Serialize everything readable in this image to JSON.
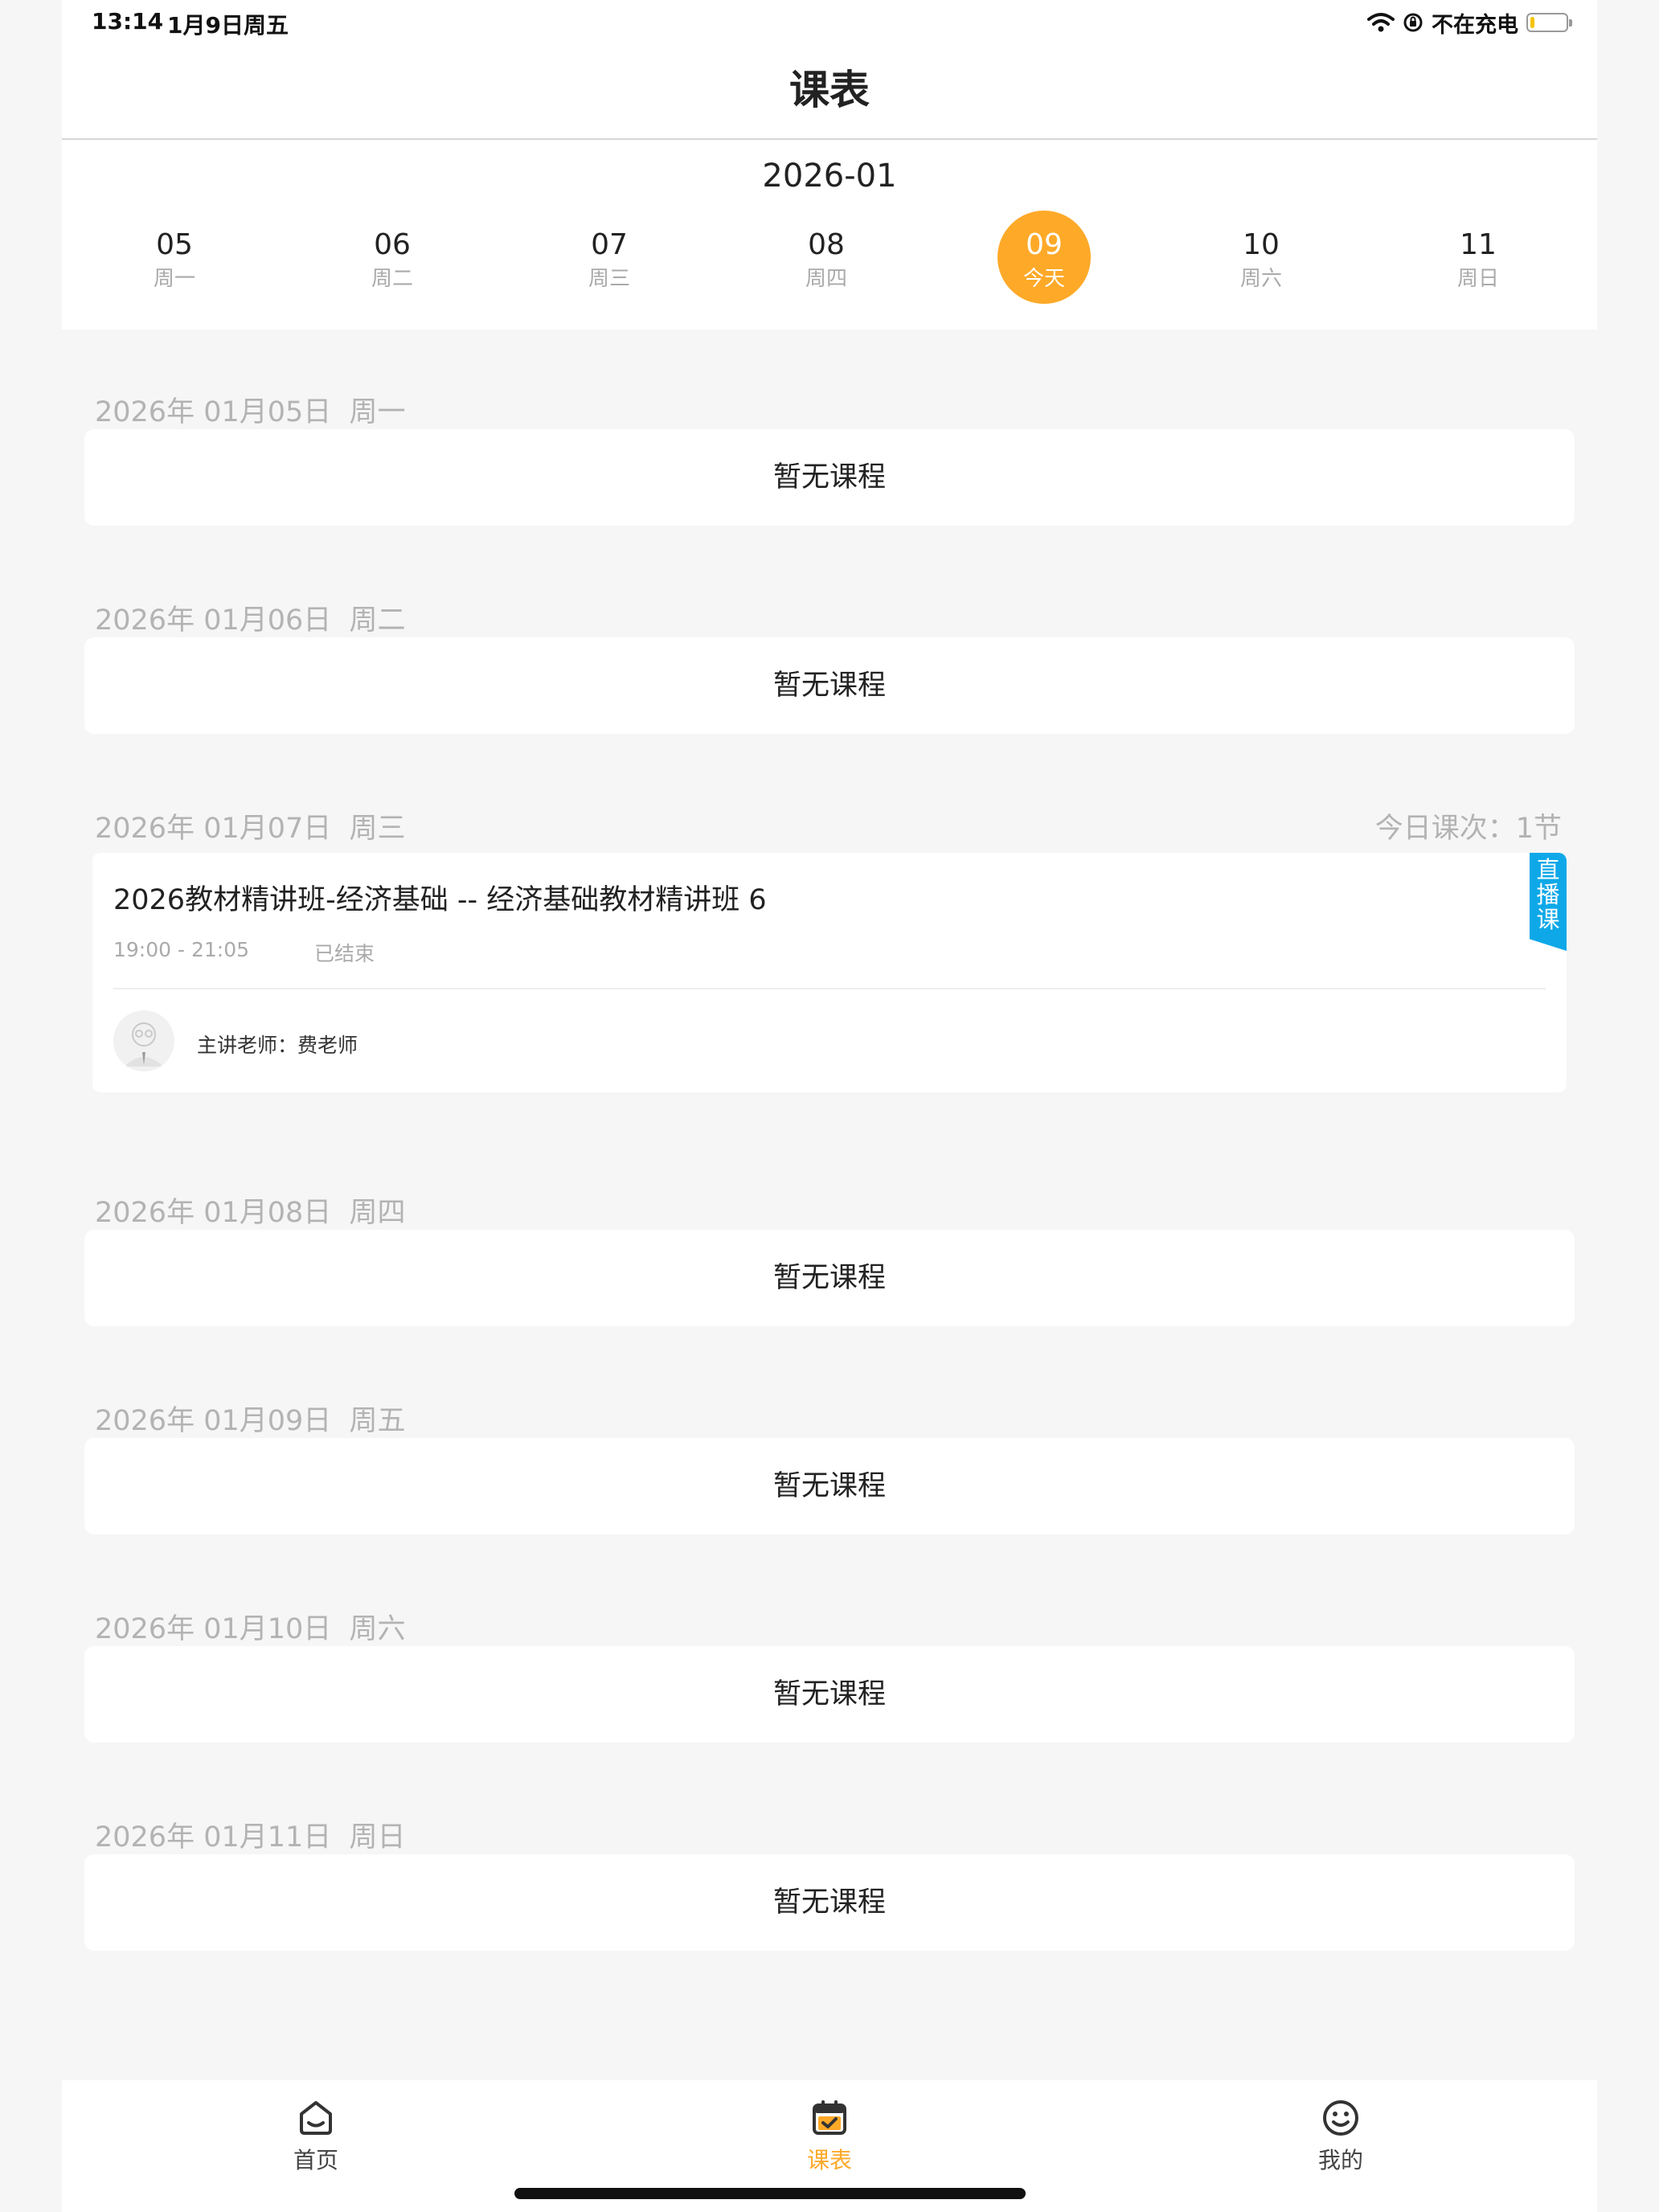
{
  "status_bar": {
    "time": "13:14",
    "date": "1月9日周五",
    "charging": "不在充电",
    "battery_level": 0.12
  },
  "header": {
    "title": "课表"
  },
  "calendar": {
    "month": "2026-01",
    "days": [
      {
        "num": "05",
        "weekday": "周一",
        "today": false
      },
      {
        "num": "06",
        "weekday": "周二",
        "today": false
      },
      {
        "num": "07",
        "weekday": "周三",
        "today": false
      },
      {
        "num": "08",
        "weekday": "周四",
        "today": false
      },
      {
        "num": "09",
        "weekday": "今天",
        "today": true
      },
      {
        "num": "10",
        "weekday": "周六",
        "today": false
      },
      {
        "num": "11",
        "weekday": "周日",
        "today": false
      }
    ]
  },
  "schedule": [
    {
      "date": "2026年 01月05日",
      "weekday": "周一",
      "empty_text": "暂无课程"
    },
    {
      "date": "2026年 01月06日",
      "weekday": "周二",
      "empty_text": "暂无课程"
    },
    {
      "date": "2026年 01月07日",
      "weekday": "周三",
      "count_label": "今日课次：1节",
      "course": {
        "title": "2026教材精讲班-经济基础 -- 经济基础教材精讲班 6",
        "time": "19:00 - 21:05",
        "status": "已结束",
        "teacher": "主讲老师：费老师",
        "tag": "直播课"
      }
    },
    {
      "date": "2026年 01月08日",
      "weekday": "周四",
      "empty_text": "暂无课程"
    },
    {
      "date": "2026年 01月09日",
      "weekday": "周五",
      "empty_text": "暂无课程"
    },
    {
      "date": "2026年 01月10日",
      "weekday": "周六",
      "empty_text": "暂无课程"
    },
    {
      "date": "2026年 01月11日",
      "weekday": "周日",
      "empty_text": "暂无课程"
    }
  ],
  "tabbar": {
    "items": [
      {
        "label": "首页",
        "icon": "home-icon",
        "active": false
      },
      {
        "label": "课表",
        "icon": "calendar-icon",
        "active": true
      },
      {
        "label": "我的",
        "icon": "smiley-icon",
        "active": false
      }
    ]
  },
  "colors": {
    "accent": "#fea928",
    "live_tag": "#0ea8e8",
    "background": "#f6f6f6"
  }
}
